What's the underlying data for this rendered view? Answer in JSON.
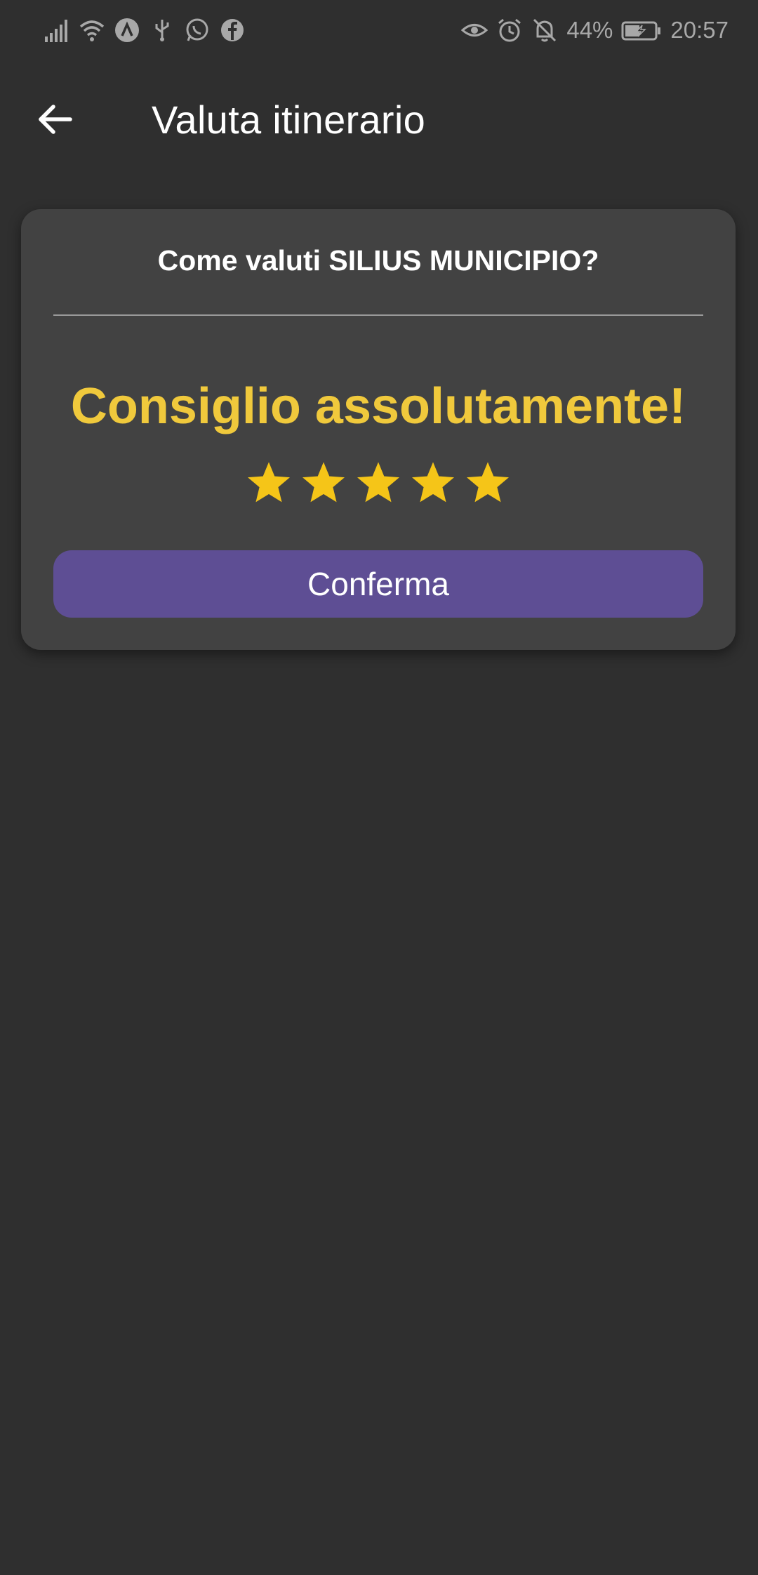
{
  "status_bar": {
    "battery": "44%",
    "time": "20:57",
    "left_icons": [
      "signal-icon",
      "wifi-icon",
      "app-icon",
      "usb-icon",
      "whatsapp-icon",
      "facebook-icon"
    ],
    "right_icons": [
      "eye-icon",
      "alarm-icon",
      "bell-off-icon",
      "battery-charging-icon"
    ]
  },
  "app_bar": {
    "title": "Valuta itinerario",
    "back_icon": "arrow-back-icon"
  },
  "card": {
    "question": "Come valuti SILIUS MUNICIPIO?",
    "rating_label": "Consiglio assolutamente!",
    "rating": 5,
    "max_rating": 5,
    "confirm_label": "Conferma"
  },
  "colors": {
    "background": "#2f2f2f",
    "card": "#424242",
    "accent_text": "#f0c93c",
    "star": "#f5c518",
    "button": "#5e4e94",
    "status_text": "#a8a8a8"
  }
}
